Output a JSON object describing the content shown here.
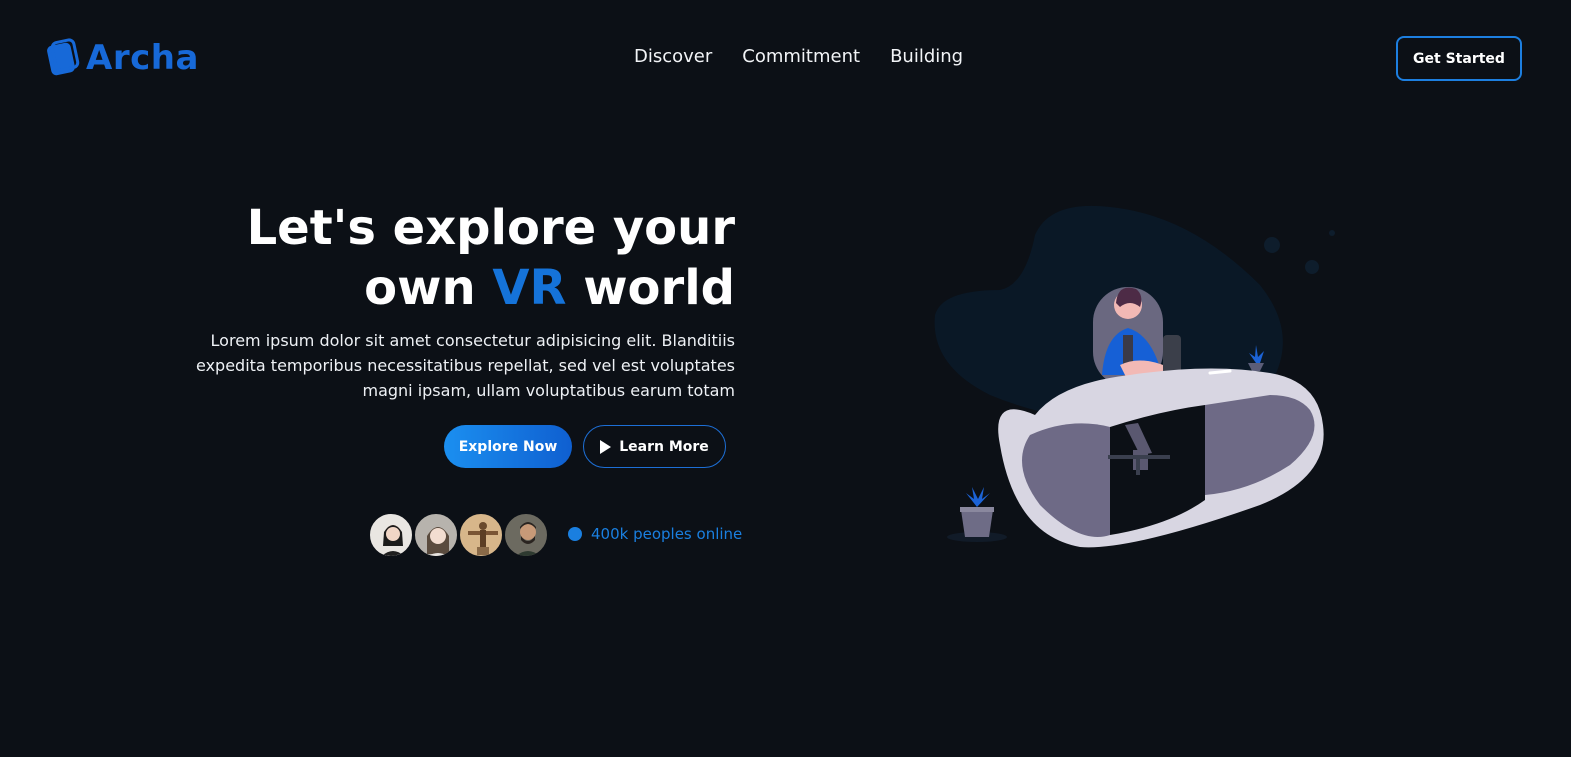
{
  "brand": {
    "name": "Archa",
    "accent_color": "#1769d8"
  },
  "nav": {
    "items": [
      "Discover",
      "Commitment",
      "Building"
    ]
  },
  "header": {
    "cta_label": "Get Started"
  },
  "hero": {
    "headline_line1": "Let's explore your",
    "headline_line2_pre": "own ",
    "headline_line2_accent": "VR",
    "headline_line2_post": " world",
    "description": "Lorem ipsum dolor sit amet consectetur adipisicing elit. Blanditiis expedita temporibus necessitatibus repellat, sed vel est voluptates magni ipsam, ullam voluptatibus earum totam",
    "primary_button": "Explore Now",
    "secondary_button": "Learn More",
    "secondary_button_icon": "play-icon",
    "online_text": "400k peoples online",
    "avatar_count": 4
  },
  "colors": {
    "background": "#0c1016",
    "accent": "#1573d9",
    "button_gradient_start": "#1b8ff0",
    "button_gradient_end": "#0f5fd0"
  }
}
